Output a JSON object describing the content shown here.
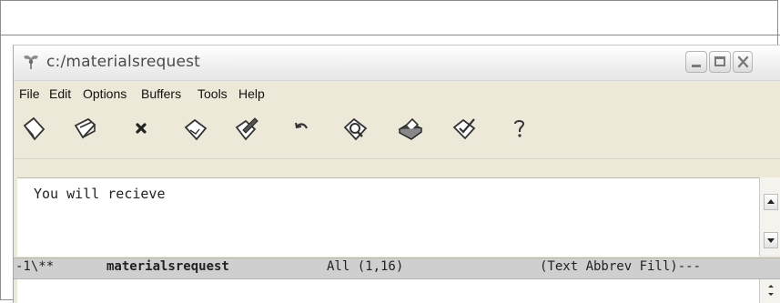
{
  "window": {
    "title": "c:/materialsrequest",
    "icon": "emacs-gnu-icon",
    "controls": {
      "minimize": "minimize-icon",
      "maximize": "maximize-icon",
      "close": "close-icon"
    }
  },
  "menubar": {
    "items": [
      "File",
      "Edit",
      "Options",
      "Buffers",
      "Tools",
      "Help"
    ]
  },
  "toolbar": {
    "buttons": [
      "new-file-icon",
      "open-folder-icon",
      "close-buffer-icon",
      "save-icon",
      "save-as-icon",
      "undo-icon",
      "search-icon",
      "print-icon",
      "spellcheck-icon",
      "help-icon"
    ]
  },
  "buffer": {
    "text": "You will recieve"
  },
  "modeline": {
    "status": "-1\\**",
    "buffer_name": "materialsrequest",
    "position": "All (1,16)",
    "modes": "(Text Abbrev Fill)---"
  },
  "colors": {
    "window_bg": "#ece9d8",
    "modeline_bg": "#cfcfcf",
    "text": "#222222"
  }
}
